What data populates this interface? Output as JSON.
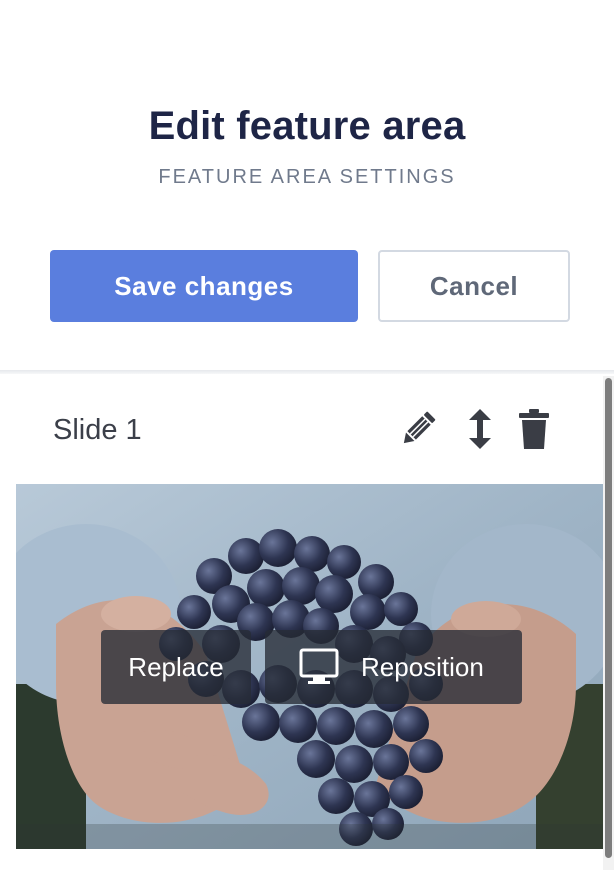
{
  "header": {
    "title": "Edit feature area",
    "subtitle": "FEATURE AREA SETTINGS",
    "save_label": "Save changes",
    "cancel_label": "Cancel"
  },
  "slide": {
    "label": "Slide 1",
    "tools": [
      "pencil-icon",
      "move-vertical-icon",
      "trash-icon"
    ],
    "image_overlay": {
      "replace_label": "Replace",
      "reposition_label": "Reposition",
      "reposition_icon": "monitor-icon"
    }
  },
  "colors": {
    "accent": "#5a7ede",
    "title": "#1e2546",
    "subtitle": "#707a8c"
  }
}
